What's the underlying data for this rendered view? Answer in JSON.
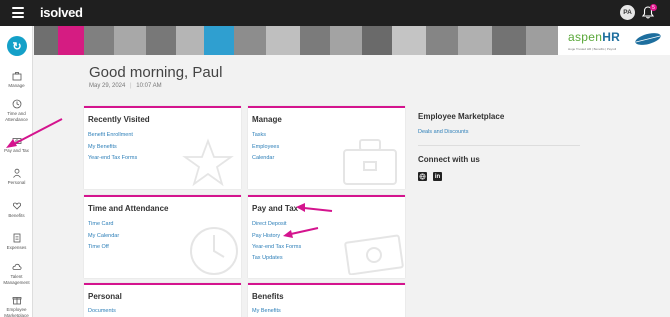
{
  "brand": {
    "name": "isolved"
  },
  "user": {
    "initials": "PA"
  },
  "notifications": {
    "count": "5",
    "icon": "bell-icon"
  },
  "sidebar": {
    "items": [
      {
        "label": "Manage",
        "icon": "briefcase-icon"
      },
      {
        "label": "Time and Attendance",
        "icon": "clock-icon"
      },
      {
        "label": "Pay and Tax",
        "icon": "money-icon"
      },
      {
        "label": "Personal",
        "icon": "person-icon"
      },
      {
        "label": "Benefits",
        "icon": "heart-hand-icon"
      },
      {
        "label": "Expenses",
        "icon": "receipt-icon"
      },
      {
        "label": "Talent Management",
        "icon": "cloud-icon"
      },
      {
        "label": "Employee Marketplace",
        "icon": "gift-icon"
      }
    ]
  },
  "banner": {
    "logo_text_1": "aspen",
    "logo_text_2": "HR",
    "tagline": "Huge Trusted HR | Benefits | Payroll"
  },
  "greeting": {
    "title": "Good morning, Paul",
    "date": "May 29, 2024",
    "time": "10:07 AM"
  },
  "cards": {
    "recently_visited": {
      "title": "Recently Visited",
      "links": [
        "Benefit Enrollment",
        "My Benefits",
        "Year-end Tax Forms"
      ]
    },
    "manage": {
      "title": "Manage",
      "links": [
        "Tasks",
        "Employees",
        "Calendar"
      ]
    },
    "time_attendance": {
      "title": "Time and Attendance",
      "links": [
        "Time Card",
        "My Calendar",
        "Time Off"
      ]
    },
    "pay_tax": {
      "title": "Pay and Tax",
      "links": [
        "Direct Deposit",
        "Pay History",
        "Year-end Tax Forms",
        "Tax Updates"
      ]
    },
    "personal": {
      "title": "Personal",
      "links": [
        "Documents"
      ]
    },
    "benefits": {
      "title": "Benefits",
      "links": [
        "My Benefits"
      ]
    }
  },
  "right": {
    "marketplace_title": "Employee Marketplace",
    "marketplace_link": "Deals and Discounts",
    "connect_title": "Connect with us",
    "social": [
      "website-icon",
      "linkedin-icon"
    ]
  },
  "colors": {
    "accent": "#d4148e",
    "link": "#2d7fb8",
    "topbar": "#1f1f1f",
    "brand_teal": "#14a0c8"
  }
}
